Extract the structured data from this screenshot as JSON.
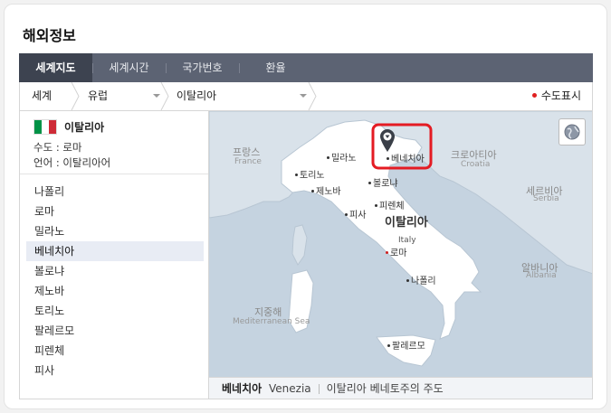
{
  "page_title": "해외정보",
  "tabs": [
    {
      "label": "세계지도",
      "active": true
    },
    {
      "label": "세계시간",
      "active": false
    },
    {
      "label": "국가번호",
      "active": false
    },
    {
      "label": "환율",
      "active": false
    }
  ],
  "breadcrumb": {
    "world": "세계",
    "continent": "유럽",
    "country": "이탈리아",
    "capital_toggle": "수도표시"
  },
  "country": {
    "name": "이탈리아",
    "capital": "수도 : 로마",
    "language": "언어 : 이탈리아어",
    "flag_colors": [
      "#009246",
      "#ffffff",
      "#ce2b37"
    ]
  },
  "cities": [
    "나폴리",
    "로마",
    "밀라노",
    "베네치아",
    "볼로냐",
    "제노바",
    "토리노",
    "팔레르모",
    "피렌체",
    "피사"
  ],
  "selected_city_index": 3,
  "map": {
    "country_label_ko": "이탈리아",
    "country_label_en": "Italy",
    "neighbors": [
      {
        "ko": "프랑스",
        "en": "France"
      },
      {
        "ko": "크로아티아",
        "en": "Croatia"
      },
      {
        "ko": "세르비아",
        "en": "Serbia"
      },
      {
        "ko": "알바니아",
        "en": "Albania"
      }
    ],
    "sea": {
      "ko": "지중해",
      "en": "Mediterranean Sea"
    },
    "city_labels": {
      "milano": "밀라노",
      "torino": "토리노",
      "genova": "제노바",
      "venezia": "베네치아",
      "bologna": "볼로냐",
      "firenze": "피렌체",
      "pisa": "피사",
      "roma": "로마",
      "napoli": "나폴리",
      "palermo": "팔레르모"
    },
    "colors": {
      "sea": "#c5d3e0",
      "land": "#ffffff",
      "highlight": "#e41b23",
      "tabs": "#5c6373"
    }
  },
  "footer": {
    "city_ko": "베네치아",
    "city_en": "Venezia",
    "description": "이탈리아 베네토주의 주도"
  }
}
